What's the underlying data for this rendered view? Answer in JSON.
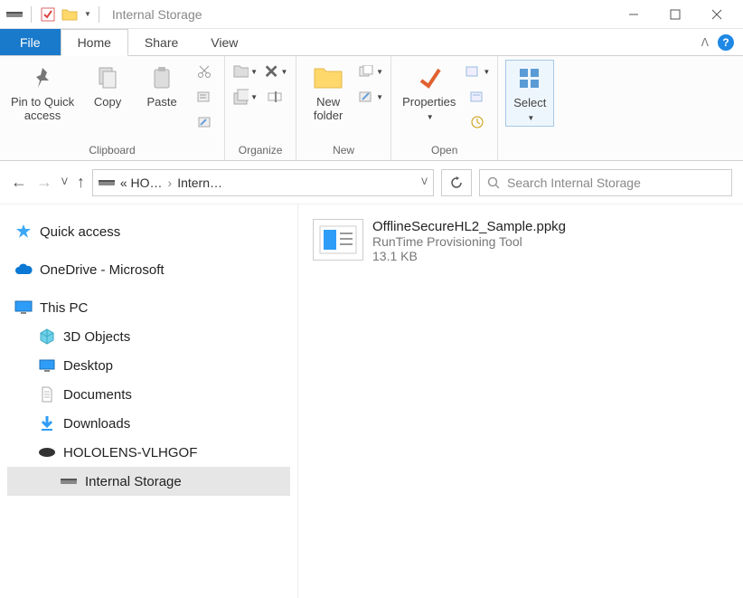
{
  "window": {
    "title": "Internal Storage"
  },
  "tabs": {
    "file": "File",
    "home": "Home",
    "share": "Share",
    "view": "View"
  },
  "ribbon": {
    "clipboard": {
      "label": "Clipboard",
      "pin": "Pin to Quick\naccess",
      "copy": "Copy",
      "paste": "Paste"
    },
    "organize": {
      "label": "Organize"
    },
    "new": {
      "label": "New",
      "newfolder": "New\nfolder"
    },
    "open": {
      "label": "Open",
      "properties": "Properties"
    },
    "select": {
      "label": "Select",
      "select": "Select"
    }
  },
  "address": {
    "crumb1": "« HO…",
    "crumb2": "Intern…"
  },
  "search": {
    "placeholder": "Search Internal Storage"
  },
  "nav": {
    "quick_access": "Quick access",
    "onedrive": "OneDrive - Microsoft",
    "this_pc": "This PC",
    "three_d": "3D Objects",
    "desktop": "Desktop",
    "documents": "Documents",
    "downloads": "Downloads",
    "hololens": "HOLOLENS-VLHGOF",
    "internal": "Internal Storage"
  },
  "file": {
    "name": "OfflineSecureHL2_Sample.ppkg",
    "type": "RunTime Provisioning Tool",
    "size": "13.1 KB"
  }
}
